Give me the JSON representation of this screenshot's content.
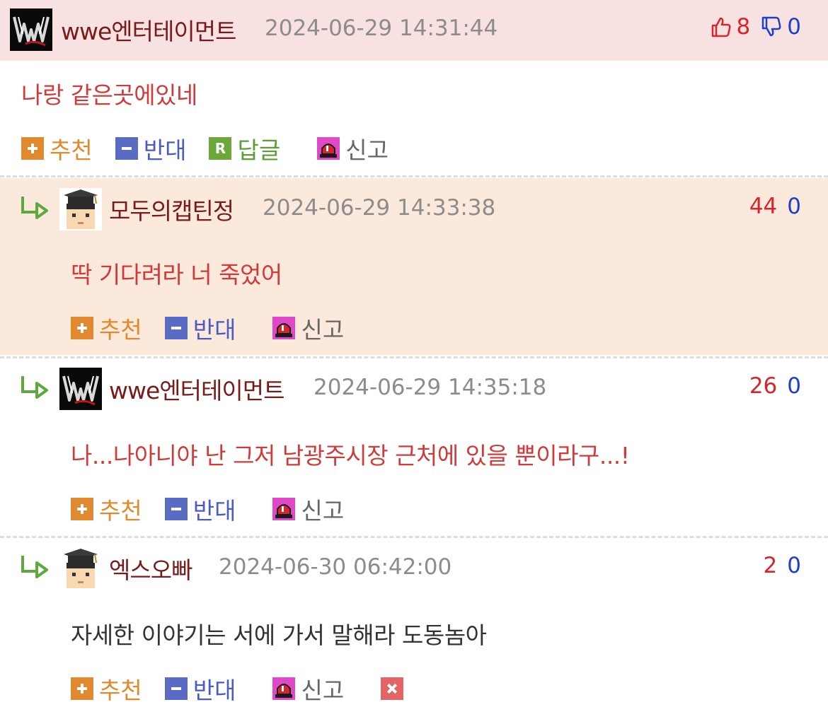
{
  "actions": {
    "recommend": "추천",
    "oppose": "반대",
    "reply": "답글",
    "report": "신고"
  },
  "comments": [
    {
      "nickname": "wwe엔터테이먼트",
      "datetime": "2024-06-29 14:31:44",
      "up": "8",
      "down": "0",
      "text": "나랑 같은곳에있네"
    },
    {
      "nickname": "모두의캡틴정",
      "datetime": "2024-06-29 14:33:38",
      "up": "44",
      "down": "0",
      "text": "딱 기다려라 너 죽었어"
    },
    {
      "nickname": "wwe엔터테이먼트",
      "datetime": "2024-06-29 14:35:18",
      "up": "26",
      "down": "0",
      "text": "나...나아니야 난 그저 남광주시장 근처에 있을 뿐이라구...!"
    },
    {
      "nickname": "엑스오빠",
      "datetime": "2024-06-30 06:42:00",
      "up": "2",
      "down": "0",
      "text": "자세한 이야기는 서에 가서 말해라 도동놈아"
    }
  ],
  "colors": {
    "top_comment_header_bg": "#f8e1e1",
    "highlight_comment_bg": "#fbe9dc",
    "nickname": "#7a1b1b",
    "comment_text_red": "#d23a3a",
    "comment_text_dark": "#333333",
    "upvote": "#d8252c",
    "downvote": "#1f3ec9"
  }
}
